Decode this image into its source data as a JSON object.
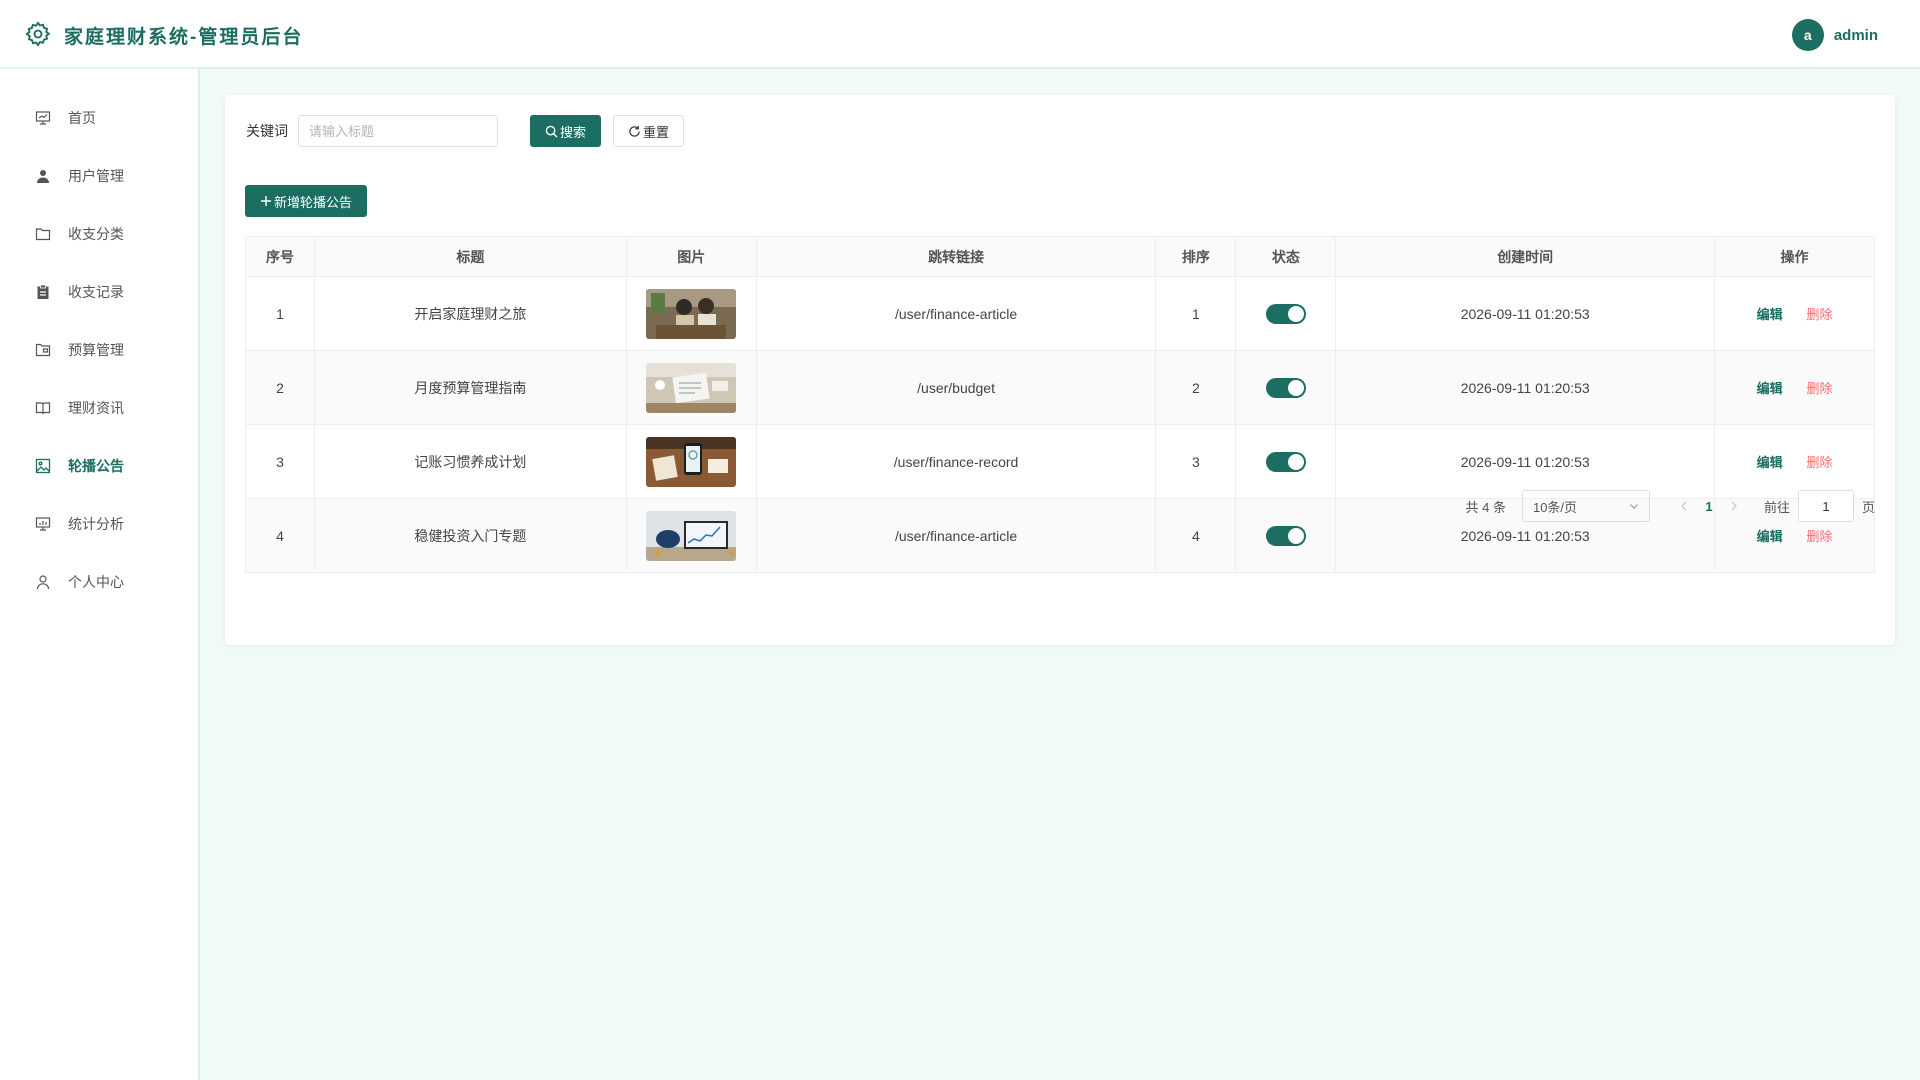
{
  "header": {
    "title": "家庭理财系统-管理员后台",
    "avatar_letter": "a",
    "username": "admin"
  },
  "sidebar": {
    "items": [
      {
        "label": "首页",
        "icon": "presentation-icon"
      },
      {
        "label": "用户管理",
        "icon": "user-icon"
      },
      {
        "label": "收支分类",
        "icon": "folder-icon"
      },
      {
        "label": "收支记录",
        "icon": "clipboard-icon"
      },
      {
        "label": "预算管理",
        "icon": "folder-open-icon"
      },
      {
        "label": "理财资讯",
        "icon": "book-icon"
      },
      {
        "label": "轮播公告",
        "icon": "picture-icon",
        "active": true
      },
      {
        "label": "统计分析",
        "icon": "chart-board-icon"
      },
      {
        "label": "个人中心",
        "icon": "person-icon"
      }
    ]
  },
  "search": {
    "label": "关键词",
    "placeholder": "请输入标题",
    "value": "",
    "search_label": "搜索",
    "reset_label": "重置"
  },
  "toolbar": {
    "add_label": "新增轮播公告"
  },
  "table": {
    "columns": [
      "序号",
      "标题",
      "图片",
      "跳转链接",
      "排序",
      "状态",
      "创建时间",
      "操作"
    ],
    "rows": [
      {
        "index": "1",
        "title": "开启家庭理财之旅",
        "image": "couple-planning-finance",
        "link": "/user/finance-article",
        "sort": "1",
        "status": true,
        "created": "2026-09-11 01:20:53",
        "edit": "编辑",
        "delete": "删除"
      },
      {
        "index": "2",
        "title": "月度预算管理指南",
        "image": "budget-documents-desk",
        "link": "/user/budget",
        "sort": "2",
        "status": true,
        "created": "2026-09-11 01:20:53",
        "edit": "编辑",
        "delete": "删除"
      },
      {
        "index": "3",
        "title": "记账习惯养成计划",
        "image": "phone-notebook-desk",
        "link": "/user/finance-record",
        "sort": "3",
        "status": true,
        "created": "2026-09-11 01:20:53",
        "edit": "编辑",
        "delete": "删除"
      },
      {
        "index": "4",
        "title": "稳健投资入门专题",
        "image": "piggy-bank-tablet-chart",
        "link": "/user/finance-article",
        "sort": "4",
        "status": true,
        "created": "2026-09-11 01:20:53",
        "edit": "编辑",
        "delete": "删除"
      }
    ]
  },
  "pagination": {
    "total_text": "共 4 条",
    "page_size": "10条/页",
    "current_page": "1",
    "goto_label": "前往",
    "goto_value": "1",
    "page_suffix": "页"
  },
  "colors": {
    "primary": "#1b6e61",
    "danger": "#f56c6c",
    "background": "#f0faf7"
  }
}
